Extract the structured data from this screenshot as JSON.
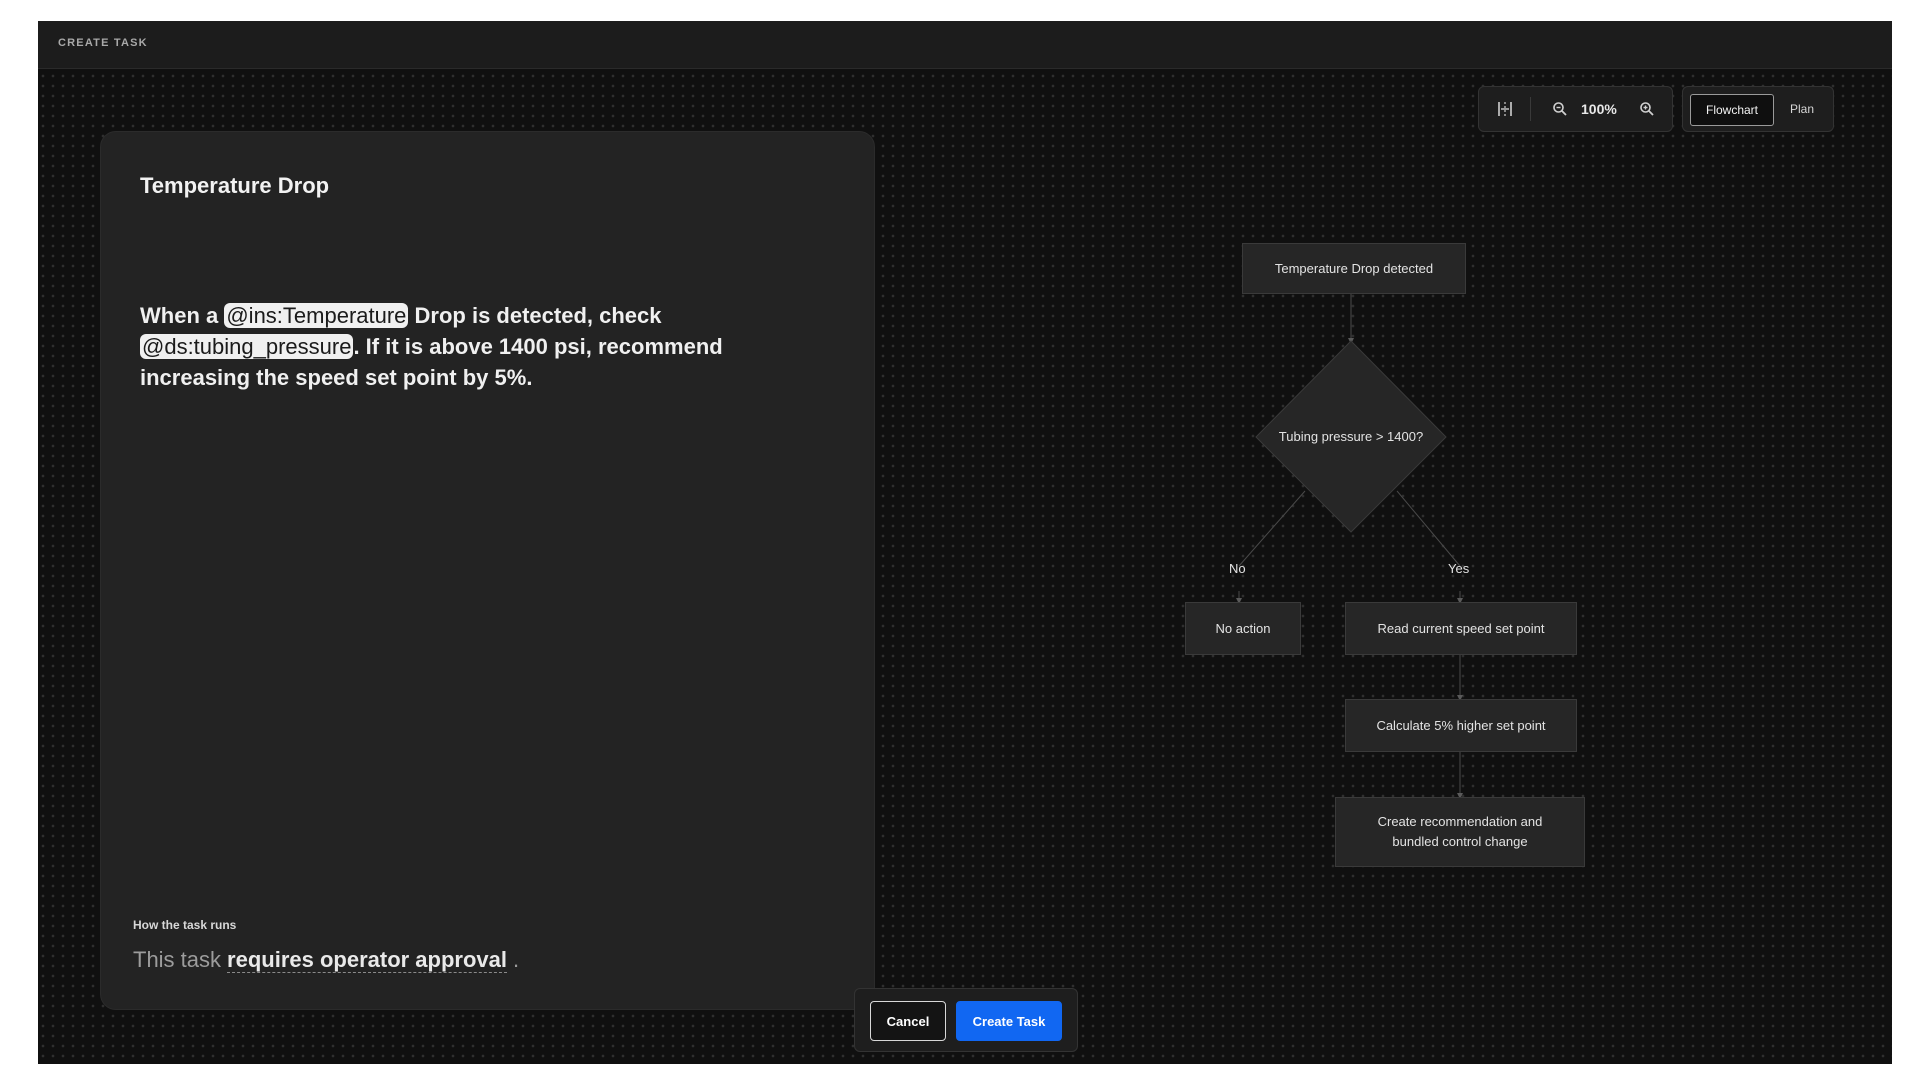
{
  "window": {
    "title": "CREATE TASK"
  },
  "task": {
    "title": "Temperature Drop",
    "description": {
      "p1": "When a ",
      "mention1": "@ins:Temperature",
      "p2": " Drop is detected, check ",
      "mention2": "@ds:tubing_pressure",
      "p3": ". If it is above 1400 psi, recommend increasing the speed set point by 5%."
    },
    "runs_label": "How the task runs",
    "runs_prefix": "This task",
    "runs_value": "requires operator approval",
    "runs_suffix": "."
  },
  "actions": {
    "cancel": "Cancel",
    "create": "Create Task"
  },
  "toolbar": {
    "layout_icon": "align-columns-icon",
    "zoom_out_icon": "zoom-out-icon",
    "zoom": "100%",
    "zoom_in_icon": "zoom-in-icon"
  },
  "view_toggle": {
    "options": [
      "Flowchart",
      "Plan"
    ],
    "selected": "Flowchart"
  },
  "flowchart": {
    "start": "Temperature Drop detected",
    "decision": "Tubing pressure > 1400?",
    "no_label": "No",
    "yes_label": "Yes",
    "no_action": "No action",
    "step1": "Read current speed set point",
    "step2": "Calculate 5% higher set point",
    "step3": "Create recommendation and bundled control change"
  }
}
